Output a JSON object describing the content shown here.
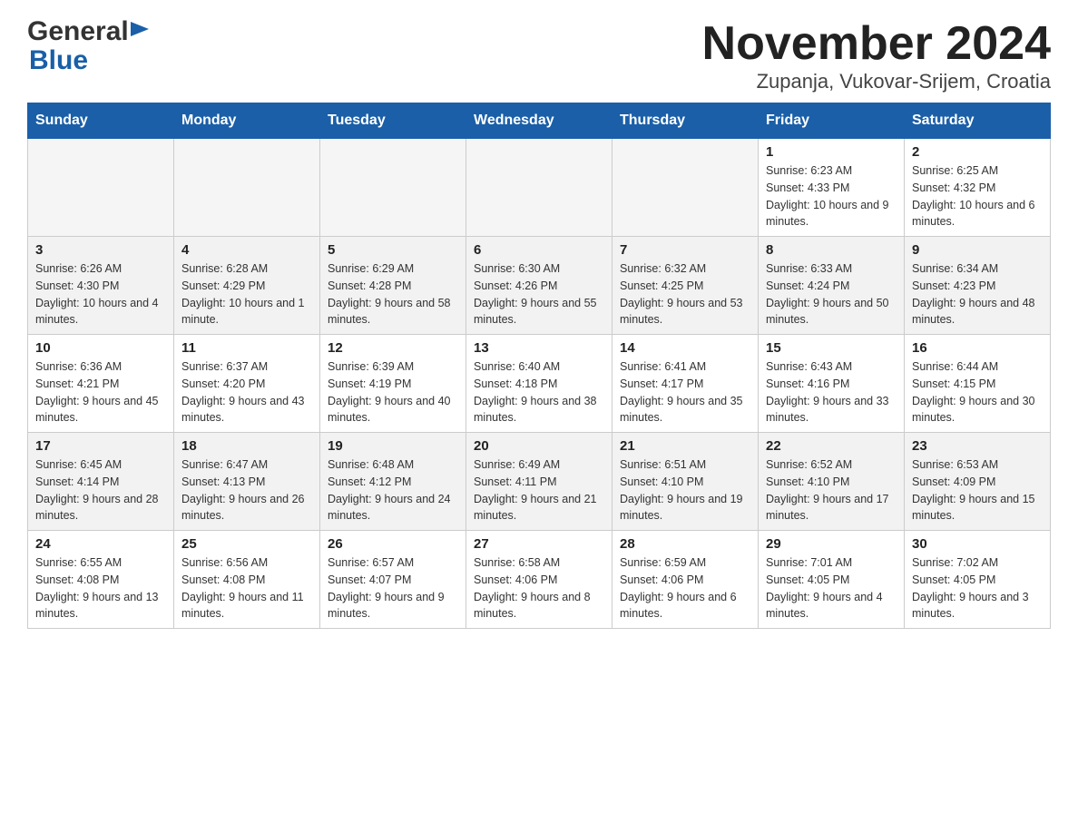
{
  "header": {
    "logo_general": "General",
    "logo_blue": "Blue",
    "title": "November 2024",
    "subtitle": "Zupanja, Vukovar-Srijem, Croatia"
  },
  "weekdays": [
    "Sunday",
    "Monday",
    "Tuesday",
    "Wednesday",
    "Thursday",
    "Friday",
    "Saturday"
  ],
  "weeks": [
    {
      "days": [
        {
          "number": "",
          "info": ""
        },
        {
          "number": "",
          "info": ""
        },
        {
          "number": "",
          "info": ""
        },
        {
          "number": "",
          "info": ""
        },
        {
          "number": "",
          "info": ""
        },
        {
          "number": "1",
          "info": "Sunrise: 6:23 AM\nSunset: 4:33 PM\nDaylight: 10 hours and 9 minutes."
        },
        {
          "number": "2",
          "info": "Sunrise: 6:25 AM\nSunset: 4:32 PM\nDaylight: 10 hours and 6 minutes."
        }
      ]
    },
    {
      "days": [
        {
          "number": "3",
          "info": "Sunrise: 6:26 AM\nSunset: 4:30 PM\nDaylight: 10 hours and 4 minutes."
        },
        {
          "number": "4",
          "info": "Sunrise: 6:28 AM\nSunset: 4:29 PM\nDaylight: 10 hours and 1 minute."
        },
        {
          "number": "5",
          "info": "Sunrise: 6:29 AM\nSunset: 4:28 PM\nDaylight: 9 hours and 58 minutes."
        },
        {
          "number": "6",
          "info": "Sunrise: 6:30 AM\nSunset: 4:26 PM\nDaylight: 9 hours and 55 minutes."
        },
        {
          "number": "7",
          "info": "Sunrise: 6:32 AM\nSunset: 4:25 PM\nDaylight: 9 hours and 53 minutes."
        },
        {
          "number": "8",
          "info": "Sunrise: 6:33 AM\nSunset: 4:24 PM\nDaylight: 9 hours and 50 minutes."
        },
        {
          "number": "9",
          "info": "Sunrise: 6:34 AM\nSunset: 4:23 PM\nDaylight: 9 hours and 48 minutes."
        }
      ]
    },
    {
      "days": [
        {
          "number": "10",
          "info": "Sunrise: 6:36 AM\nSunset: 4:21 PM\nDaylight: 9 hours and 45 minutes."
        },
        {
          "number": "11",
          "info": "Sunrise: 6:37 AM\nSunset: 4:20 PM\nDaylight: 9 hours and 43 minutes."
        },
        {
          "number": "12",
          "info": "Sunrise: 6:39 AM\nSunset: 4:19 PM\nDaylight: 9 hours and 40 minutes."
        },
        {
          "number": "13",
          "info": "Sunrise: 6:40 AM\nSunset: 4:18 PM\nDaylight: 9 hours and 38 minutes."
        },
        {
          "number": "14",
          "info": "Sunrise: 6:41 AM\nSunset: 4:17 PM\nDaylight: 9 hours and 35 minutes."
        },
        {
          "number": "15",
          "info": "Sunrise: 6:43 AM\nSunset: 4:16 PM\nDaylight: 9 hours and 33 minutes."
        },
        {
          "number": "16",
          "info": "Sunrise: 6:44 AM\nSunset: 4:15 PM\nDaylight: 9 hours and 30 minutes."
        }
      ]
    },
    {
      "days": [
        {
          "number": "17",
          "info": "Sunrise: 6:45 AM\nSunset: 4:14 PM\nDaylight: 9 hours and 28 minutes."
        },
        {
          "number": "18",
          "info": "Sunrise: 6:47 AM\nSunset: 4:13 PM\nDaylight: 9 hours and 26 minutes."
        },
        {
          "number": "19",
          "info": "Sunrise: 6:48 AM\nSunset: 4:12 PM\nDaylight: 9 hours and 24 minutes."
        },
        {
          "number": "20",
          "info": "Sunrise: 6:49 AM\nSunset: 4:11 PM\nDaylight: 9 hours and 21 minutes."
        },
        {
          "number": "21",
          "info": "Sunrise: 6:51 AM\nSunset: 4:10 PM\nDaylight: 9 hours and 19 minutes."
        },
        {
          "number": "22",
          "info": "Sunrise: 6:52 AM\nSunset: 4:10 PM\nDaylight: 9 hours and 17 minutes."
        },
        {
          "number": "23",
          "info": "Sunrise: 6:53 AM\nSunset: 4:09 PM\nDaylight: 9 hours and 15 minutes."
        }
      ]
    },
    {
      "days": [
        {
          "number": "24",
          "info": "Sunrise: 6:55 AM\nSunset: 4:08 PM\nDaylight: 9 hours and 13 minutes."
        },
        {
          "number": "25",
          "info": "Sunrise: 6:56 AM\nSunset: 4:08 PM\nDaylight: 9 hours and 11 minutes."
        },
        {
          "number": "26",
          "info": "Sunrise: 6:57 AM\nSunset: 4:07 PM\nDaylight: 9 hours and 9 minutes."
        },
        {
          "number": "27",
          "info": "Sunrise: 6:58 AM\nSunset: 4:06 PM\nDaylight: 9 hours and 8 minutes."
        },
        {
          "number": "28",
          "info": "Sunrise: 6:59 AM\nSunset: 4:06 PM\nDaylight: 9 hours and 6 minutes."
        },
        {
          "number": "29",
          "info": "Sunrise: 7:01 AM\nSunset: 4:05 PM\nDaylight: 9 hours and 4 minutes."
        },
        {
          "number": "30",
          "info": "Sunrise: 7:02 AM\nSunset: 4:05 PM\nDaylight: 9 hours and 3 minutes."
        }
      ]
    }
  ]
}
